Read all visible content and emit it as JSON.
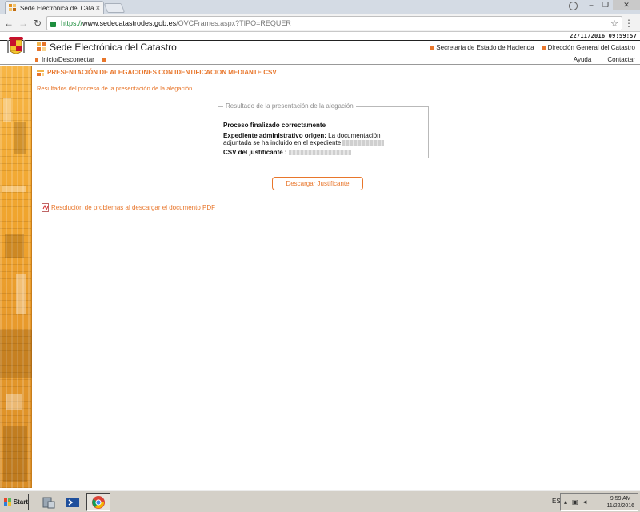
{
  "browser": {
    "tab_title": "Sede Electrónica del Catast",
    "tab_close": "×",
    "url_scheme": "https://",
    "url_host": "www.sedecatastrodes.gob.es",
    "url_path": "/OVCFrames.aspx?TIPO=REQUER",
    "back_icon": "←",
    "forward_icon": "→",
    "reload_icon": "↻",
    "star_icon": "☆",
    "menu_icon": "⋮",
    "win_min": "–",
    "win_max": "❐",
    "win_close": "✕"
  },
  "site": {
    "date": "22/11/2016 09:59:57",
    "brand": "Sede Electrónica del Catastro",
    "header_links": [
      "Secretaría de Estado de Hacienda",
      "Dirección General del Catastro"
    ],
    "nav_left": "Inicio/Desconectar",
    "nav_right": [
      "Ayuda",
      "Contactar"
    ],
    "accent_color": "#e8762b"
  },
  "main": {
    "title": "PRESENTACIÓN DE ALEGACIONES CON IDENTIFICACION MEDIANTE CSV",
    "subtitle": "Resultados del proceso de la presentación de la alegación",
    "result_legend": "Resultado de la presentación de la alegación",
    "status_text": "Proceso finalizado correctamente",
    "expediente_label": "Expediente administrativo origen:",
    "expediente_text_1": "La documentación",
    "expediente_text_2": "adjuntada se ha incluido en el expediente",
    "csv_label": "CSV del justificante :",
    "download_button": "Descargar Justificante",
    "pdf_help_link": "Resolución de problemas al descargar el documento PDF"
  },
  "taskbar": {
    "start_label": "Start",
    "language": "ES",
    "time": "9:59 AM",
    "date": "11/22/2016"
  }
}
